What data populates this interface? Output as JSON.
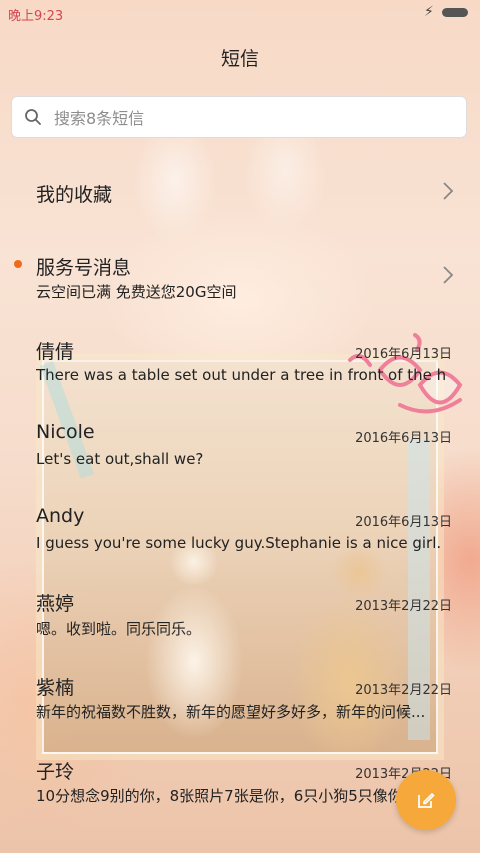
{
  "status_bar": {
    "time": "晚上9:23"
  },
  "header": {
    "title": "短信"
  },
  "search": {
    "placeholder": "搜索8条短信"
  },
  "favorites": {
    "label": "我的收藏"
  },
  "service": {
    "title": "服务号消息",
    "snippet": "云空间已满 免费送您20G空间"
  },
  "conversations": [
    {
      "name": "倩倩",
      "date": "2016年6月13日",
      "snippet": "There was a table set out under a tree in front of the ho..."
    },
    {
      "name": "Nicole",
      "date": "2016年6月13日",
      "snippet": "Let's eat out,shall we?"
    },
    {
      "name": "Andy",
      "date": "2016年6月13日",
      "snippet": "I guess you're some lucky guy.Stephanie is a nice girl."
    },
    {
      "name": "燕婷",
      "date": "2013年2月22日",
      "snippet": "嗯。收到啦。同乐同乐。"
    },
    {
      "name": "紫楠",
      "date": "2013年2月22日",
      "snippet": "新年的祝福数不胜数，新年的愿望好多好多，新年的问候..."
    },
    {
      "name": "子玲",
      "date": "2013年2月22日",
      "snippet": "10分想念9别的你，8张照片7张是你，6只小狗5只像你"
    }
  ],
  "colors": {
    "accent_orange": "#f06a1a",
    "fab": "#f6a93a",
    "status_time": "#d6464f"
  },
  "icons": {
    "search": "search-icon",
    "chevron": "chevron-right-icon",
    "compose": "compose-icon"
  }
}
